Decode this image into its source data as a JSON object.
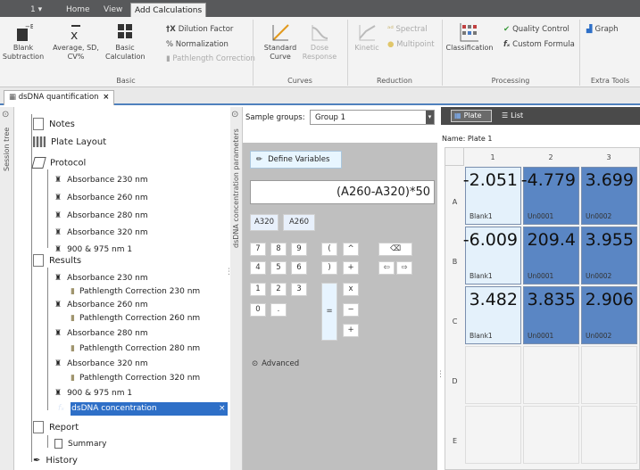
{
  "title_bar": {
    "app_menu": "1 ▾",
    "tabs": [
      "Home",
      "View",
      "Add Calculations"
    ]
  },
  "ribbon": {
    "basic": {
      "label": "Basic",
      "blank_subtraction": "Blank\nSubtraction",
      "average": "Average, SD,\nCV%",
      "basic_calculation": "Basic\nCalculation",
      "dilution_factor": "Dilution Factor",
      "normalization": "Normalization",
      "pathlength": "Pathlength Correction"
    },
    "curves": {
      "label": "Curves",
      "standard_curve": "Standard\nCurve",
      "dose_response": "Dose\nResponse"
    },
    "reduction": {
      "label": "Reduction",
      "kinetic": "Kinetic",
      "spectral": "Spectral",
      "multipoint": "Multipoint"
    },
    "processing": {
      "label": "Processing",
      "classification": "Classification",
      "quality_control": "Quality Control",
      "custom_formula": "Custom Formula"
    },
    "extra": {
      "label": "Extra Tools",
      "graph": "Graph"
    }
  },
  "document_tab": {
    "label": "dsDNA quantification",
    "close": "×"
  },
  "session_tree": {
    "strip_label": "Session tree",
    "notes": "Notes",
    "plate_layout": "Plate Layout",
    "protocol": "Protocol",
    "protocol_items": [
      "Absorbance 230 nm",
      "Absorbance 260 nm",
      "Absorbance 280 nm",
      "Absorbance 320 nm",
      "900 & 975 nm 1"
    ],
    "results": "Results",
    "results_items": [
      "Absorbance 230 nm",
      "Pathlength Correction 230 nm",
      "Absorbance 260 nm",
      "Pathlength Correction 260 nm",
      "Absorbance 280 nm",
      "Pathlength Correction 280 nm",
      "Absorbance 320 nm",
      "Pathlength Correction 320 nm",
      "900 & 975 nm 1",
      "dsDNA concentration"
    ],
    "report": "Report",
    "summary": "Summary",
    "history": "History"
  },
  "params": {
    "strip_label": "dsDNA concentration parameters",
    "sample_groups_label": "Sample groups:",
    "sample_groups_value": "Group 1",
    "define_variables": "Define Variables",
    "formula": "(A260-A320)*50",
    "variables": [
      "A320",
      "A260"
    ],
    "keys_row1": [
      "7",
      "8",
      "9",
      "(",
      "^"
    ],
    "keys_row2": [
      "4",
      "5",
      "6",
      ")",
      "+"
    ],
    "keys_row3": [
      "1",
      "2",
      "3",
      "x"
    ],
    "keys_row4": [
      "0",
      ".",
      "=",
      "−"
    ],
    "key_plus": "+",
    "backspace": "⌫",
    "arrow_left": "⇦",
    "arrow_right": "⇨",
    "advanced": "Advanced"
  },
  "plate": {
    "view_plate": "Plate",
    "view_list": "List",
    "name_label": "Name:",
    "name_value": "Plate 1",
    "columns": [
      "1",
      "2",
      "3"
    ],
    "rows": [
      "A",
      "B",
      "C",
      "D",
      "E"
    ],
    "cells": [
      [
        {
          "value": "-2.051",
          "label": "Blank1"
        },
        {
          "value": "-4.779",
          "label": "Un0001"
        },
        {
          "value": "3.699",
          "label": "Un0002"
        }
      ],
      [
        {
          "value": "-6.009",
          "label": "Blank1"
        },
        {
          "value": "209.4",
          "label": "Un0001"
        },
        {
          "value": "3.955",
          "label": "Un0002"
        }
      ],
      [
        {
          "value": "3.482",
          "label": "Blank1"
        },
        {
          "value": "3.835",
          "label": "Un0001"
        },
        {
          "value": "2.906",
          "label": "Un0002"
        }
      ]
    ]
  }
}
